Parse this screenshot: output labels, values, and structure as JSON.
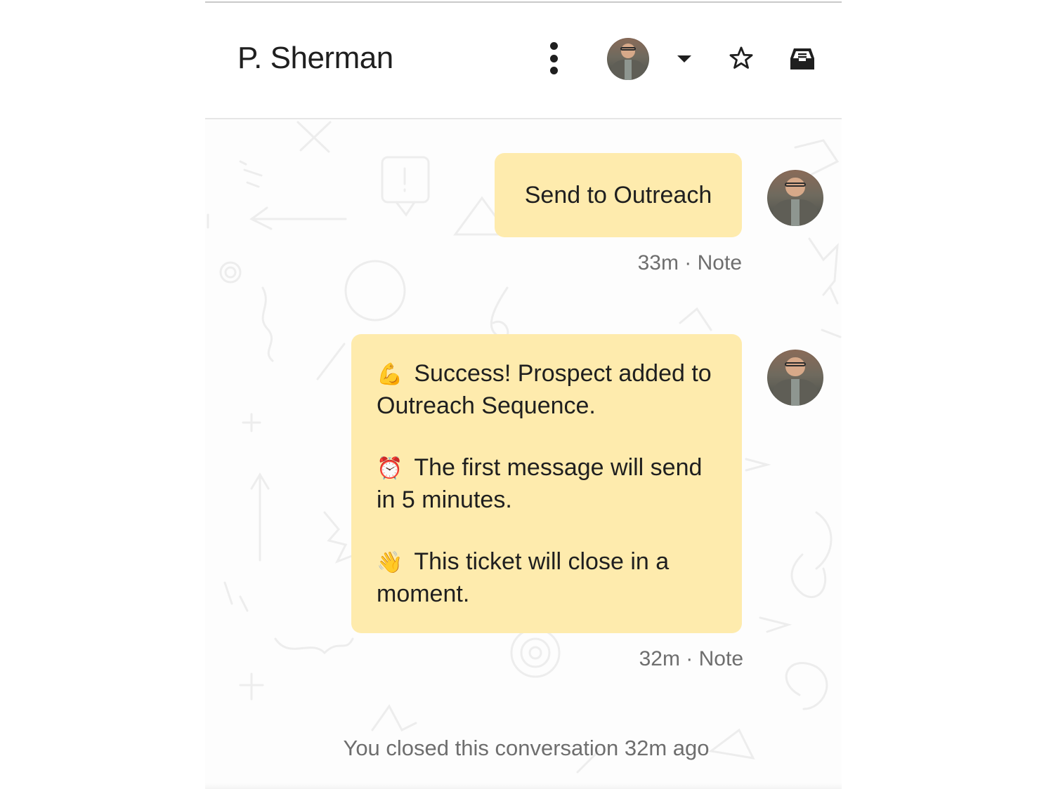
{
  "header": {
    "contact_name": "P. Sherman",
    "icons": [
      "more-options-icon",
      "assignee-avatar",
      "caret-down-icon",
      "star-icon",
      "inbox-icon"
    ]
  },
  "conversation": {
    "messages": [
      {
        "type": "note",
        "text": "Send to Outreach",
        "time": "33m",
        "kind": "Note",
        "meta": "33m · Note"
      },
      {
        "type": "note",
        "paragraphs": [
          {
            "emoji": "💪",
            "emoji_name": "flexed-biceps-icon",
            "text": "Success! Prospect added to Outreach Sequence."
          },
          {
            "emoji": "⏰",
            "emoji_name": "alarm-clock-icon",
            "text": "The first message will send in 5 minutes."
          },
          {
            "emoji": "👋",
            "emoji_name": "waving-hand-icon",
            "text": "This ticket will close in a moment."
          }
        ],
        "time": "32m",
        "kind": "Note",
        "meta": "32m · Note"
      }
    ],
    "status_event": "You closed this conversation 32m ago"
  },
  "colors": {
    "note_bubble": "#feebad",
    "text_primary": "#1f1f1f",
    "text_secondary": "#6e6e6e",
    "divider": "#e6e6e6"
  }
}
